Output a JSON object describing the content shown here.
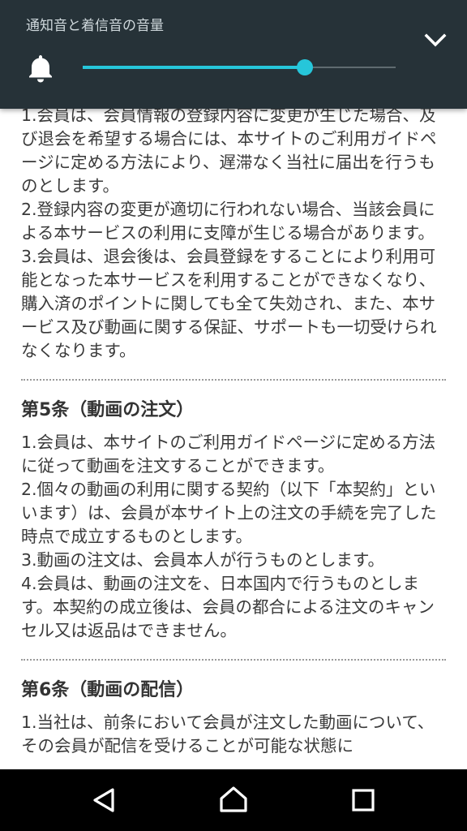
{
  "volume_panel": {
    "title": "通知音と着信音の音量",
    "level": 0.71,
    "icons": {
      "stream": "bell-icon",
      "collapse": "chevron-down-icon"
    },
    "colors": {
      "panel_bg": "#263238",
      "accent": "#26c6da"
    }
  },
  "document": {
    "section4_paragraphs": [
      "1.会員は、会員情報の登録内容に変更が生じた場合、及び退会を希望する場合には、本サイトのご利用ガイドページに定める方法により、遅滞なく当社に届出を行うものとします。",
      "2.登録内容の変更が適切に行われない場合、当該会員による本サービスの利用に支障が生じる場合があります。",
      "3.会員は、退会後は、会員登録をすることにより利用可能となった本サービスを利用することができなくなり、購入済のポイントに関しても全て失効され、また、本サービス及び動画に関する保証、サポートも一切受けられなくなります。"
    ],
    "section5": {
      "title": "第5条（動画の注文）",
      "paragraphs": [
        "1.会員は、本サイトのご利用ガイドページに定める方法に従って動画を注文することができます。",
        "2.個々の動画の利用に関する契約（以下「本契約」といいます）は、会員が本サイト上の注文の手続を完了した時点で成立するものとします。",
        "3.動画の注文は、会員本人が行うものとします。",
        "4.会員は、動画の注文を、日本国内で行うものとします。本契約の成立後は、会員の都合による注文のキャンセル又は返品はできません。"
      ]
    },
    "section6": {
      "title": "第6条（動画の配信）",
      "paragraphs": [
        "1.当社は、前条において会員が注文した動画について、その会員が配信を受けることが可能な状態に"
      ]
    }
  },
  "nav_bar": {
    "icons": [
      "back-icon",
      "home-icon",
      "recents-icon"
    ]
  }
}
